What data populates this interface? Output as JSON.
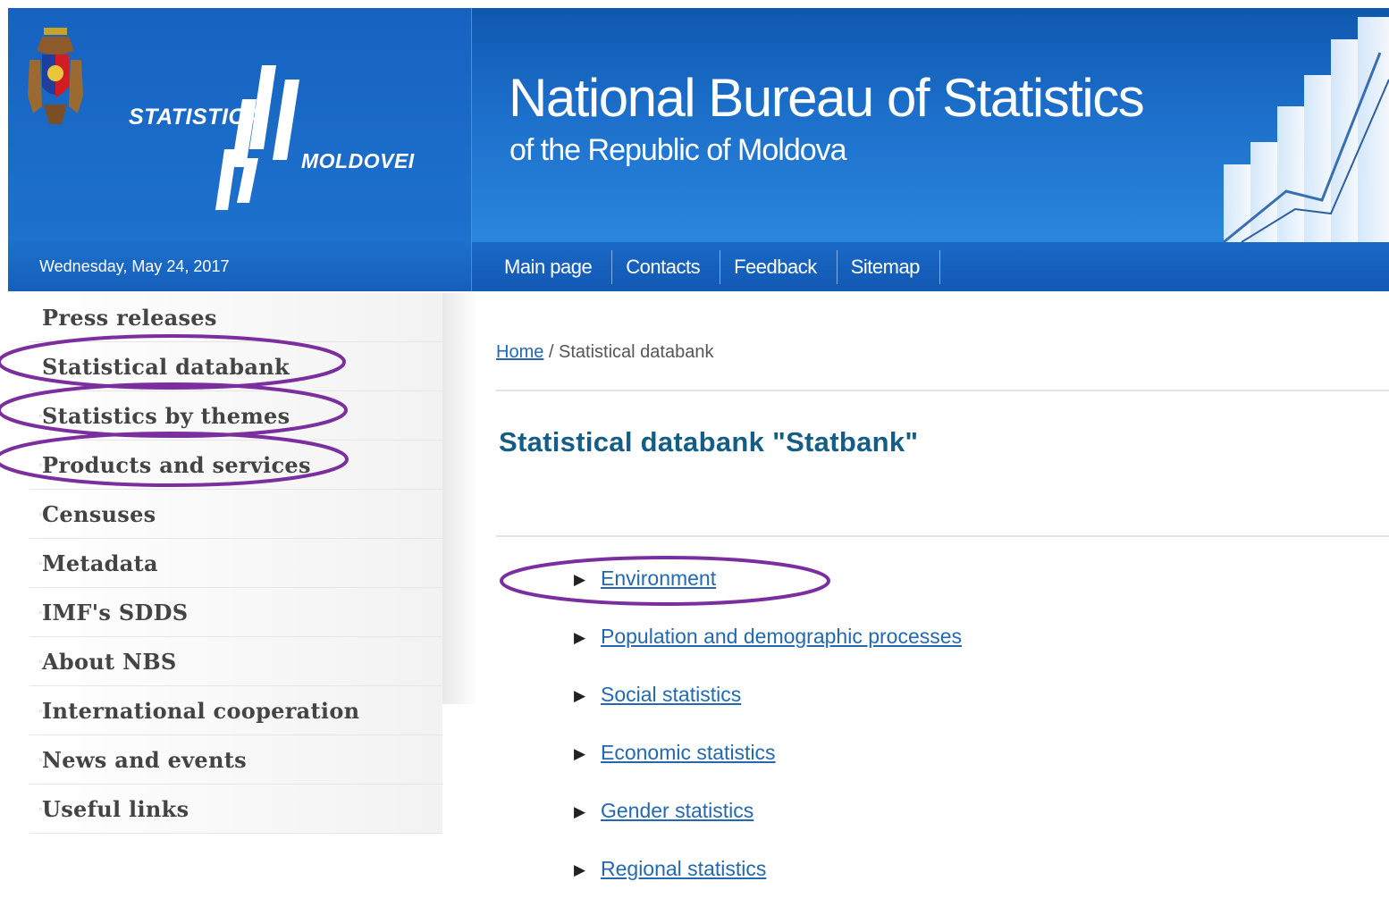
{
  "header": {
    "brand_line_1": "STATISTICA",
    "brand_line_2": "MOLDOVEI",
    "title": "National Bureau of Statistics",
    "subtitle": "of the Republic of Moldova",
    "coat_of_arms_icon": "moldova-coat-of-arms-icon",
    "bars_icon": "statistica-bars-logo-icon"
  },
  "navbar": {
    "date": "Wednesday, May 24, 2017",
    "items": [
      {
        "label": "Main page"
      },
      {
        "label": "Contacts"
      },
      {
        "label": "Feedback"
      },
      {
        "label": "Sitemap"
      }
    ]
  },
  "sidebar": {
    "items": [
      {
        "label": "Press releases",
        "bullet": false
      },
      {
        "label": "Statistical databank",
        "bullet": false
      },
      {
        "label": "Statistics by themes",
        "bullet": true
      },
      {
        "label": "Products and services",
        "bullet": true
      },
      {
        "label": "Censuses",
        "bullet": true
      },
      {
        "label": "Metadata",
        "bullet": true
      },
      {
        "label": "IMF's SDDS",
        "bullet": true
      },
      {
        "label": "About NBS",
        "bullet": true
      },
      {
        "label": "International cooperation",
        "bullet": true
      },
      {
        "label": "News and events",
        "bullet": true
      },
      {
        "label": "Useful links",
        "bullet": true
      }
    ]
  },
  "breadcrumb": {
    "home": "Home",
    "separator": " / ",
    "current": "Statistical databank"
  },
  "main": {
    "title": "Statistical databank \"Statbank\"",
    "categories": [
      {
        "label": "Environment"
      },
      {
        "label": "Population and demographic processes"
      },
      {
        "label": "Social statistics"
      },
      {
        "label": "Economic statistics"
      },
      {
        "label": "Gender statistics"
      },
      {
        "label": "Regional statistics"
      }
    ]
  },
  "colors": {
    "header_blue": "#1c6fca",
    "title_teal": "#145d87",
    "link_blue": "#2468b0",
    "annotation_purple": "#7b2f9e"
  }
}
